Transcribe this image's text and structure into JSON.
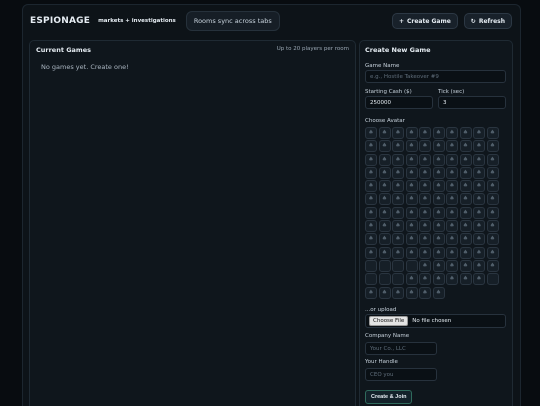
{
  "header": {
    "brand": "ESPIONAGE",
    "tagline": "markets + investigations",
    "sync_badge": "Rooms sync across tabs",
    "create_game_label": "Create Game",
    "create_game_icon": "+",
    "refresh_label": "Refresh",
    "refresh_icon": "↻"
  },
  "games_panel": {
    "title": "Current Games",
    "hint": "Up to 20 players per room",
    "empty_text": "No games yet. Create one!"
  },
  "create_panel": {
    "title": "Create New Game",
    "game_name_label": "Game Name",
    "game_name_placeholder": "e.g., Hostile Takeover #9",
    "starting_cash_label": "Starting Cash ($)",
    "starting_cash_value": "250000",
    "tick_label": "Tick (sec)",
    "tick_value": "3",
    "avatar_label": "Choose Avatar",
    "avatar_icon": "spade-icon",
    "upload_label": "...or upload",
    "choose_file_label": "Choose File",
    "no_file_text": "No file chosen",
    "company_name_label": "Company Name",
    "company_name_placeholder": "Your Co., LLC",
    "handle_label": "Your Handle",
    "handle_placeholder": "CEO you",
    "submit_label": "Create & Join"
  },
  "colors": {
    "background": "#080c10",
    "panel": "#0f161c",
    "accent_border": "#2f6a5c"
  }
}
